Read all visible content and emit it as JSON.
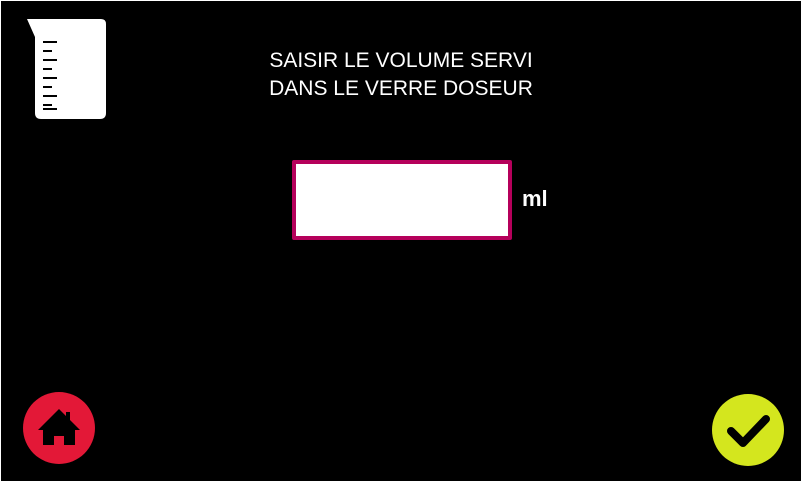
{
  "header": {
    "icon": "measuring-cup-icon",
    "prompt_line1": "SAISIR LE VOLUME SERVI",
    "prompt_line2": "DANS LE VERRE DOSEUR"
  },
  "volume": {
    "value": "",
    "unit": "ml"
  },
  "footer": {
    "home_icon": "home-icon",
    "confirm_icon": "checkmark-icon"
  },
  "colors": {
    "background": "#000000",
    "text": "#ffffff",
    "input_border": "#b5005b",
    "home_button": "#e31837",
    "confirm_button": "#d4e61e"
  }
}
